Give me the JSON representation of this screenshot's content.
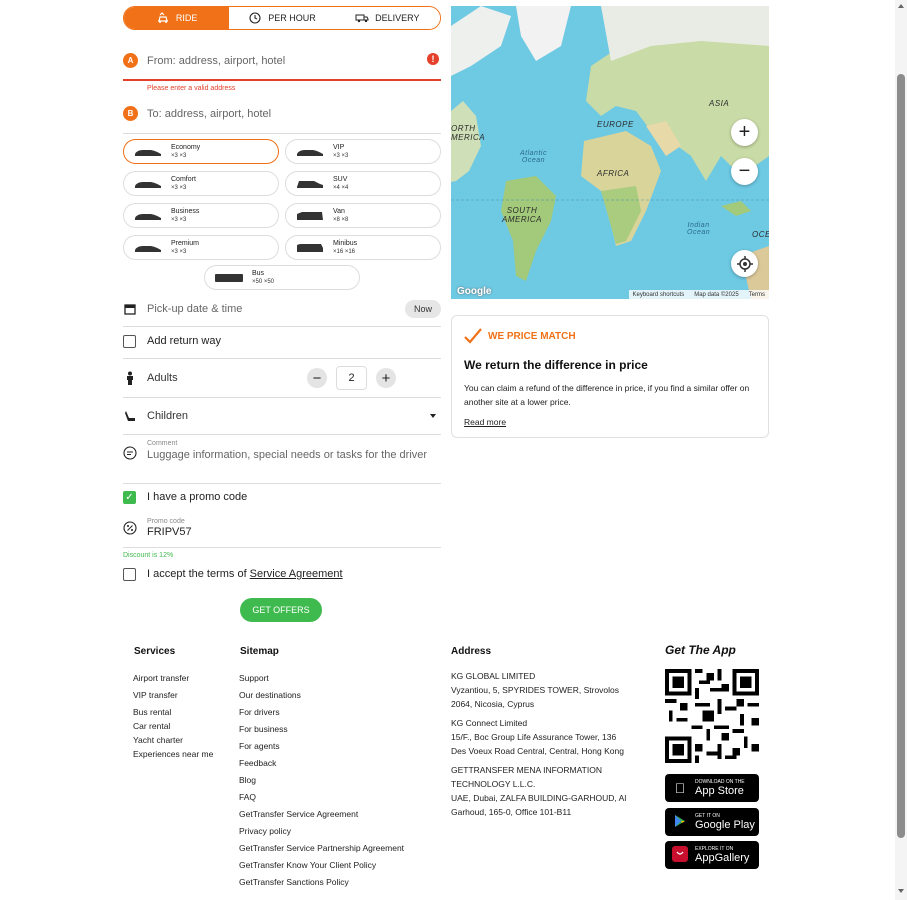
{
  "tabs": [
    {
      "label": "RIDE",
      "icon": "ride-icon",
      "active": true
    },
    {
      "label": "PER HOUR",
      "icon": "clock-icon",
      "active": false
    },
    {
      "label": "DELIVERY",
      "icon": "delivery-truck-icon",
      "active": false
    }
  ],
  "from": {
    "marker": "A",
    "placeholder": "From: address, airport, hotel",
    "error": "Please enter a valid address",
    "error_icon": "!"
  },
  "to": {
    "marker": "B",
    "placeholder": "To: address, airport, hotel"
  },
  "cars": [
    {
      "name": "Economy",
      "capacity": "×3  ×3",
      "selected": true
    },
    {
      "name": "VIP",
      "capacity": "×3  ×3"
    },
    {
      "name": "Comfort",
      "capacity": "×3  ×3"
    },
    {
      "name": "SUV",
      "capacity": "×4  ×4"
    },
    {
      "name": "Business",
      "capacity": "×3  ×3"
    },
    {
      "name": "Van",
      "capacity": "×8  ×8"
    },
    {
      "name": "Premium",
      "capacity": "×3  ×3"
    },
    {
      "name": "Minibus",
      "capacity": "×16  ×16"
    },
    {
      "name": "Bus",
      "capacity": "×50  ×50"
    }
  ],
  "pickup": {
    "placeholder": "Pick-up date & time",
    "now_label": "Now"
  },
  "return_way": {
    "label": "Add return way"
  },
  "adults": {
    "label": "Adults",
    "minus": "−",
    "value": "2",
    "plus": "+"
  },
  "children": {
    "label": "Children"
  },
  "comment": {
    "label": "Comment",
    "placeholder": "Luggage information, special needs or tasks for the driver"
  },
  "promo": {
    "checkbox_label": "I have a promo code",
    "field_label": "Promo code",
    "value": "FRIPV57",
    "note": "Discount is 12%",
    "check_mark": "✓"
  },
  "terms": {
    "prefix": "I accept the terms of",
    "link": "Service Agreement"
  },
  "offers_button": "GET OFFERS",
  "map": {
    "labels": [
      "ASIA",
      "EUROPE",
      "ORTH\nMERICA",
      "AFRICA",
      "SOUTH\nAMERICA",
      "OCE"
    ],
    "oceans": [
      "Atlantic\nOcean",
      "Indian\nOcean"
    ],
    "zoom_in": "+",
    "zoom_out": "−",
    "footer": [
      "Keyboard shortcuts",
      "Map data ©2025",
      "Terms"
    ],
    "logo": "Google"
  },
  "price_match": {
    "heading": "WE PRICE MATCH",
    "title": "We return the difference in price",
    "description": "You can claim a refund of the difference in price, if you find a similar offer on another site at a lower price.",
    "link": "Read more"
  },
  "footer": {
    "services_title": "Services",
    "services": [
      "Airport transfer",
      "VIP transfer",
      "Bus rental",
      "Car rental",
      "Yacht charter",
      "Experiences near me"
    ],
    "sitemap_title": "Sitemap",
    "sitemap": [
      "Support",
      "Our destinations",
      "For drivers",
      "For business",
      "For agents",
      "Feedback",
      "Blog",
      "FAQ",
      "GetTransfer Service Agreement",
      "Privacy policy",
      "GetTransfer Service Partnership Agreement",
      "GetTransfer Know Your Client Policy",
      "GetTransfer Sanctions Policy"
    ],
    "address_title": "Address",
    "addresses": [
      [
        "KG GLOBAL LIMITED",
        "Vyzantiou, 5, SPYRIDES TOWER, Strovolos",
        "2064, Nicosia, Cyprus"
      ],
      [
        "KG Connect Limited",
        "15/F., Boc Group Life Assurance Tower, 136",
        "Des Voeux Road Central, Central, Hong Kong"
      ],
      [
        "GETTRANSFER MENA INFORMATION",
        "TECHNOLOGY L.L.C.",
        "UAE, Dubai, ZALFA BUILDING-GARHOUD, Al",
        "Garhoud, 165-0, Office 101-B11"
      ]
    ],
    "app_title": "Get The App",
    "stores": [
      {
        "small": "Download on the",
        "big": "App Store",
        "icon": "apple-icon"
      },
      {
        "small": "GET IT ON",
        "big": "Google Play",
        "icon": "google-play-icon"
      },
      {
        "small": "EXPLORE IT ON",
        "big": "AppGallery",
        "icon": "huawei-appgallery-icon"
      }
    ]
  }
}
